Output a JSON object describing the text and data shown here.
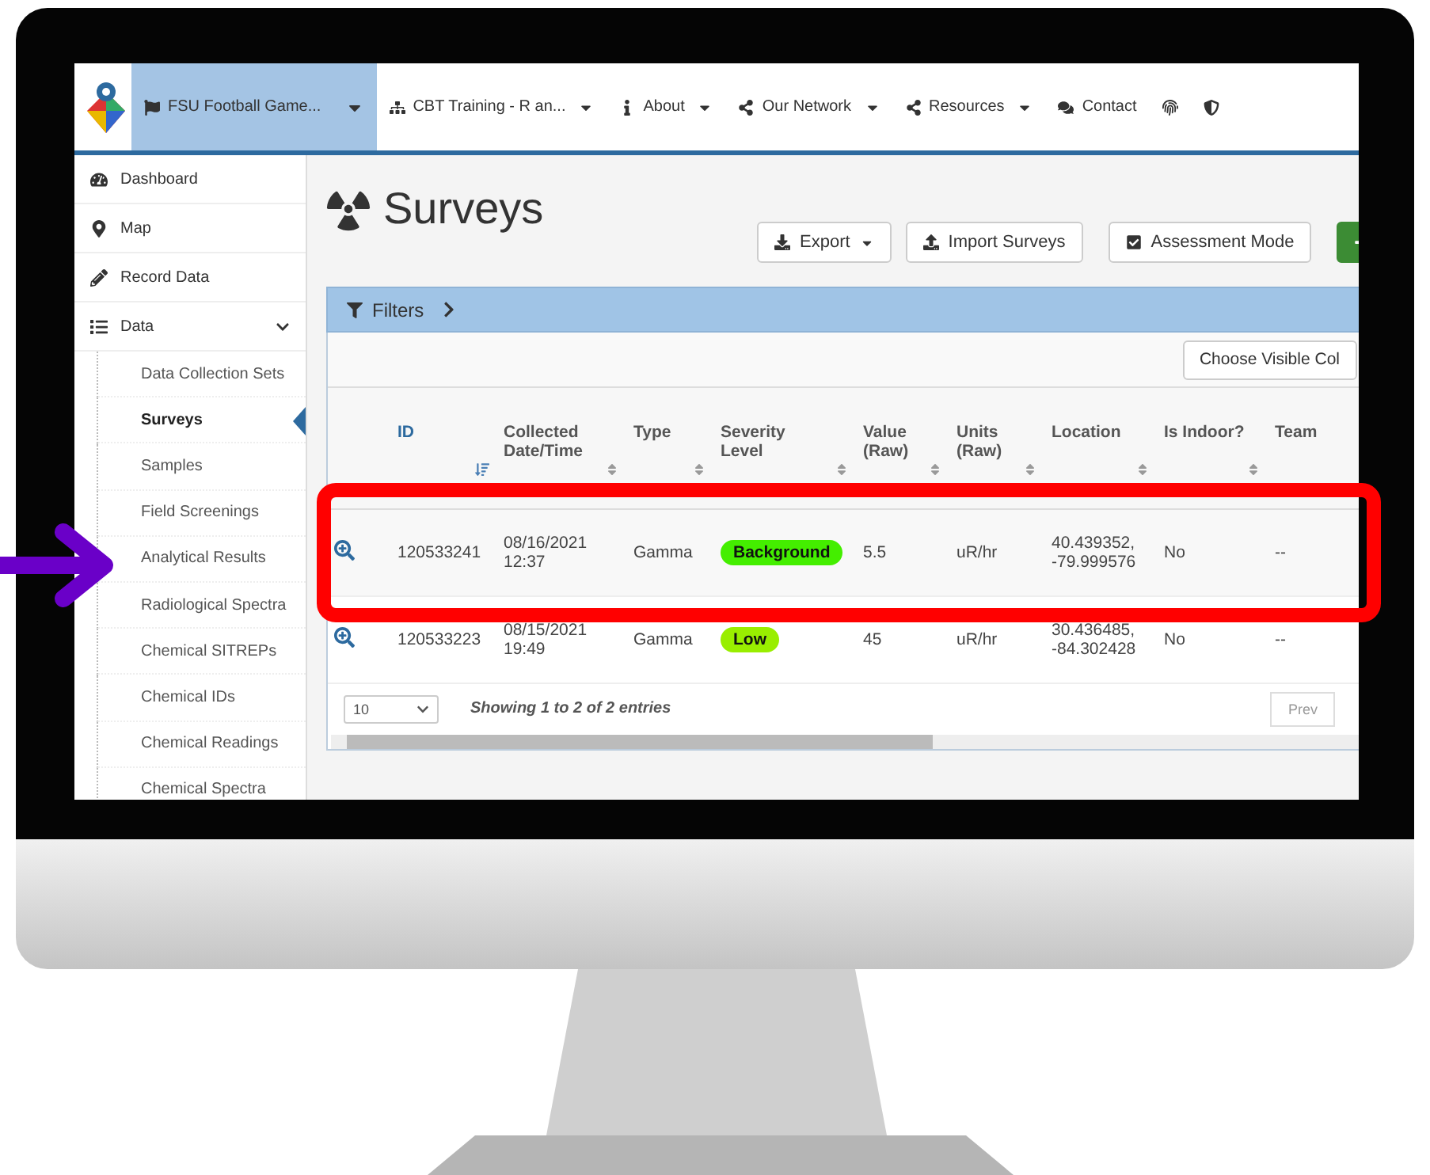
{
  "navbar": {
    "items": [
      {
        "label": "FSU Football Game...",
        "kind": "dropdown",
        "selected": true
      },
      {
        "label": "CBT Training - R an...",
        "kind": "dropdown",
        "selected": false
      },
      {
        "label": "About",
        "kind": "dropdown",
        "selected": false
      },
      {
        "label": "Our Network",
        "kind": "dropdown",
        "selected": false
      },
      {
        "label": "Resources",
        "kind": "dropdown",
        "selected": false
      },
      {
        "label": "Contact",
        "kind": "link",
        "selected": false
      },
      {
        "kind": "icon",
        "selected": false
      },
      {
        "kind": "icon",
        "selected": false
      }
    ]
  },
  "sidebar": {
    "items": [
      {
        "label": "Dashboard",
        "selected": false
      },
      {
        "label": "Map",
        "selected": false
      },
      {
        "label": "Record Data",
        "selected": false
      },
      {
        "label": "Data",
        "selected": false,
        "expanded": true,
        "children": [
          {
            "label": "Data Collection Sets",
            "selected": false
          },
          {
            "label": "Surveys",
            "selected": true
          },
          {
            "label": "Samples",
            "selected": false
          },
          {
            "label": "Field Screenings",
            "selected": false
          },
          {
            "label": "Analytical Results",
            "selected": false
          },
          {
            "label": "Radiological Spectra",
            "selected": false
          },
          {
            "label": "Chemical SITREPs",
            "selected": false
          },
          {
            "label": "Chemical IDs",
            "selected": false
          },
          {
            "label": "Chemical Readings",
            "selected": false
          },
          {
            "label": "Chemical Spectra",
            "selected": false
          }
        ]
      }
    ]
  },
  "page": {
    "title": "Surveys",
    "toolbar": [
      {
        "label": "Export",
        "kind": "dropdown"
      },
      {
        "label": "Import Surveys",
        "kind": "upload"
      },
      {
        "label": "Assessment Mode",
        "kind": "check"
      },
      {
        "kind": "add"
      }
    ],
    "filters": {
      "label": "Filters",
      "expanded": false
    },
    "columns_button": "Choose Visible Col",
    "table": {
      "columns": [
        {
          "label": "ID",
          "sorted": true
        },
        {
          "label": "Collected Date/Time",
          "sorted": false
        },
        {
          "label": "Type",
          "sorted": false
        },
        {
          "label": "Severity Level",
          "sorted": false
        },
        {
          "label": "Value (Raw)",
          "sorted": false
        },
        {
          "label": "Units (Raw)",
          "sorted": false
        },
        {
          "label": "Location",
          "sorted": false
        },
        {
          "label": "Is Indoor?",
          "sorted": false
        },
        {
          "label": "Team",
          "sorted": false
        }
      ],
      "rows": [
        {
          "id": "120533241",
          "date": "08/16/2021",
          "time": "12:37",
          "type": "Gamma",
          "severity": "Background",
          "color": "#44ee00",
          "value": "5.5",
          "units": "uR/hr",
          "lat": "40.439352,",
          "lon": "-79.999576",
          "indoor": "No",
          "team": "--"
        },
        {
          "id": "120533223",
          "date": "08/15/2021",
          "time": "19:49",
          "type": "Gamma",
          "severity": "Low",
          "color": "#99ee00",
          "value": "45",
          "units": "uR/hr",
          "lat": "30.436485,",
          "lon": "-84.302428",
          "indoor": "No",
          "team": "--"
        }
      ]
    },
    "page_size": "10",
    "info": "Showing 1 to 2 of 2 entries",
    "pager": "Prev"
  }
}
